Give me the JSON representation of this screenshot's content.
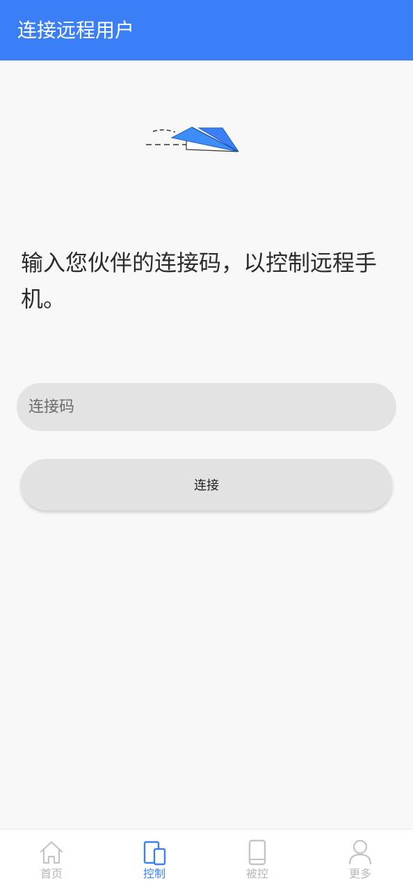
{
  "app_bar": {
    "title": "连接远程用户"
  },
  "prompt": "输入您伙伴的连接码，以控制远程手机。",
  "code_input": {
    "placeholder": "连接码",
    "value": ""
  },
  "connect_button": {
    "label": "连接"
  },
  "bottom_nav": {
    "items": [
      {
        "label": "首页",
        "icon": "home-icon",
        "active": false
      },
      {
        "label": "控制",
        "icon": "devices-icon",
        "active": true
      },
      {
        "label": "被控",
        "icon": "phone-icon",
        "active": false
      },
      {
        "label": "更多",
        "icon": "person-icon",
        "active": false
      }
    ]
  },
  "colors": {
    "primary": "#3a7ff5",
    "inactive": "#b8b8b8",
    "background": "#f8f8f8"
  }
}
